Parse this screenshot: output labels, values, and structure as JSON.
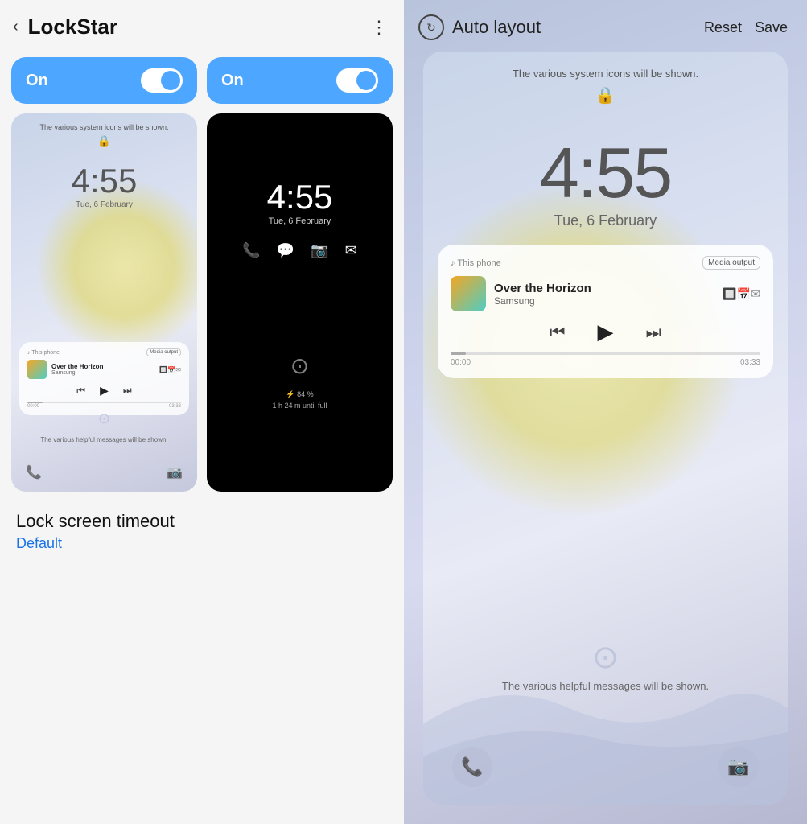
{
  "left": {
    "header": {
      "title": "LockStar",
      "back_label": "←",
      "more_label": "⋮"
    },
    "toggle1": {
      "label": "On",
      "state": true
    },
    "toggle2": {
      "label": "On",
      "state": true
    },
    "preview_light": {
      "top_text": "The various system icons will be shown.",
      "time": "4:55",
      "date": "Tue, 6 February",
      "bottom_text": "The various helpful messages will be shown.",
      "music": {
        "source": "♪ This phone",
        "output_btn": "Media output",
        "title": "Over the Horizon",
        "artist": "Samsung",
        "time_start": "00:00",
        "time_end": "03:33"
      }
    },
    "preview_dark": {
      "time": "4:55",
      "date": "Tue, 6 February",
      "battery_text": "⚡ 84 %",
      "battery_sub": "1 h 24 m until full"
    },
    "timeout": {
      "title": "Lock screen timeout",
      "subtitle": "Default"
    }
  },
  "right": {
    "header": {
      "icon_label": "↻",
      "title": "Auto layout",
      "reset_label": "Reset",
      "save_label": "Save"
    },
    "preview": {
      "top_text": "The various system icons will be shown.",
      "time": "4:55",
      "date": "Tue, 6 February",
      "bottom_text": "The various helpful messages will be shown.",
      "music": {
        "source": "♪ This phone",
        "output_btn": "Media output",
        "title": "Over the Horizon",
        "artist": "Samsung",
        "time_start": "00:00",
        "time_end": "03:33"
      }
    }
  }
}
